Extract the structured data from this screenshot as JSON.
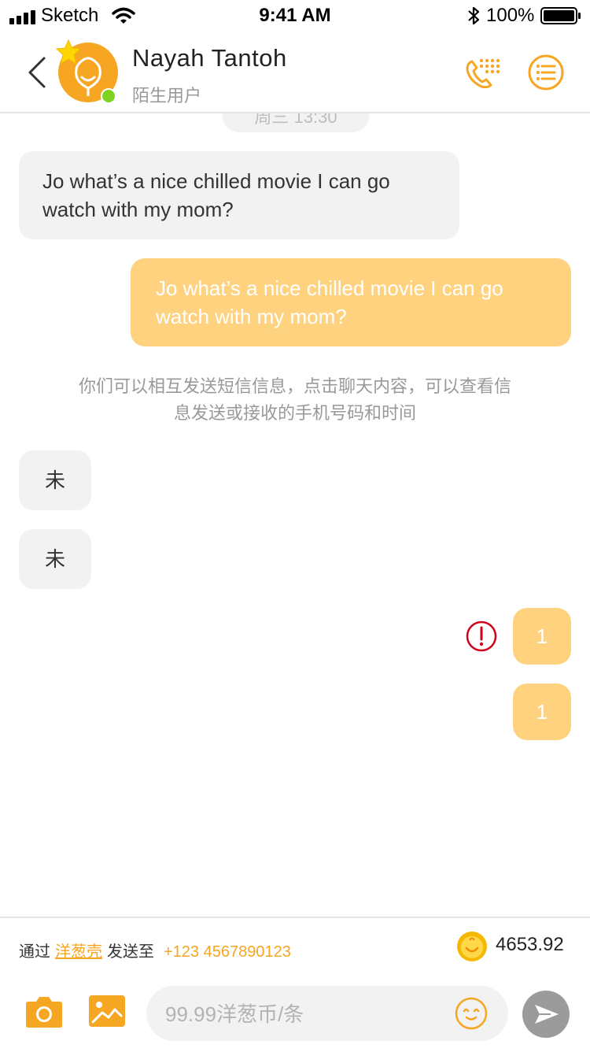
{
  "status_bar": {
    "carrier": "Sketch",
    "time": "9:41 AM",
    "battery": "100%"
  },
  "header": {
    "name": "Nayah Tantoh",
    "subtitle": "陌生用户",
    "icons": [
      "back-chevron-icon",
      "star-icon",
      "dialer-icon",
      "list-menu-icon"
    ],
    "accent_color": "#f5a623",
    "online_color": "#7ed321"
  },
  "chat": {
    "timestamp": "周三  13:30",
    "messages": [
      {
        "direction": "in",
        "text": "Jo what’s a nice chilled movie I can go watch with my mom?"
      },
      {
        "direction": "out",
        "text": "Jo what’s a nice chilled movie I can go watch with my mom?"
      },
      {
        "direction": "in",
        "text": "未"
      },
      {
        "direction": "in",
        "text": "未"
      },
      {
        "direction": "out",
        "text": "1",
        "status": "failed"
      },
      {
        "direction": "out",
        "text": "1"
      }
    ],
    "notice": "你们可以相互发送短信信息，点击聊天内容，可以查看信息发送或接收的手机号码和时间",
    "incoming_bubble_color": "#f2f2f2",
    "outgoing_bubble_color": "#ffd27f",
    "error_color": "#d0021b"
  },
  "footer": {
    "via_label": "通过",
    "via_link": "洋葱壳",
    "send_to_label": "发送至",
    "phone": "+123 4567890123",
    "balance": "4653.92",
    "input_placeholder": "99.99洋葱币/条",
    "icons": [
      "camera-icon",
      "gallery-icon",
      "emoji-icon",
      "send-icon",
      "coin-icon"
    ]
  }
}
